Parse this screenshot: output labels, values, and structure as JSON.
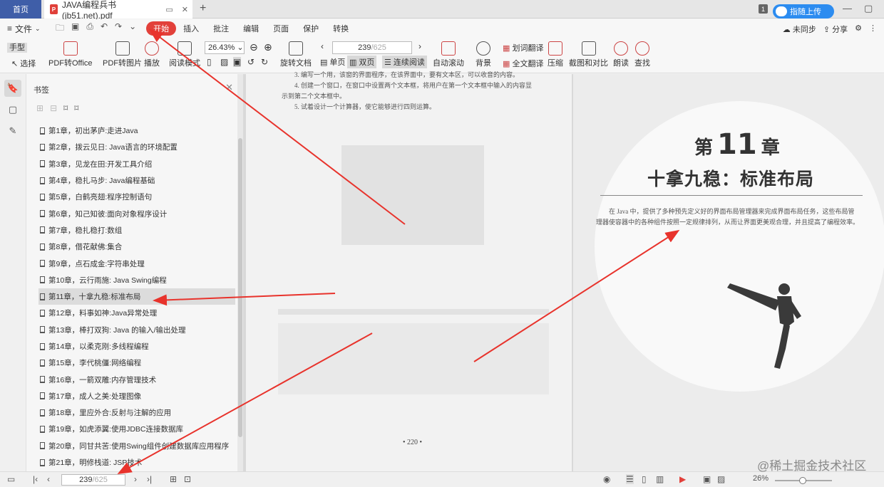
{
  "titlebar": {
    "home_tab": "首页",
    "doc_tab": "JAVA编程兵书(jb51.net).pdf",
    "badge": "1",
    "upload": "指随上传"
  },
  "menubar": {
    "file": "文件",
    "items": [
      "开始",
      "插入",
      "批注",
      "编辑",
      "页面",
      "保护",
      "转换"
    ],
    "right": [
      "未同步",
      "分享"
    ]
  },
  "ribbon": {
    "hand": "手型",
    "select": "选择",
    "pdf_office": "PDF转Office",
    "pdf_image": "PDF转图片",
    "play": "播放",
    "read_mode": "阅读模式",
    "zoom": "26.43%",
    "page_current": "239",
    "page_total": "/625",
    "rotate": "旋转文档",
    "single": "单页",
    "double": "双页",
    "continuous": "连续阅读",
    "autoscroll": "自动滚动",
    "background": "背景",
    "word_translate": "划词翻译",
    "full_translate": "全文翻译",
    "compress": "压缩",
    "screenshot": "截图和对比",
    "read_aloud": "朗读",
    "find": "查找"
  },
  "bookmarks": {
    "title": "书签",
    "items": [
      "第1章，初出茅庐:走进Java",
      "第2章，拨云见日: Java语言的环境配置",
      "第3章，见龙在田:开发工具介绍",
      "第4章，稳扎马步: Java编程基础",
      "第5章，白鹤亮翅:程序控制语句",
      "第6章，知己知彼:面向对象程序设计",
      "第7章，稳扎稳打:数组",
      "第8章，借花献佛:集合",
      "第9章，点石成金:字符串处理",
      "第10章，云行雨施: Java Swing编程",
      "第11章，十拿九稳:标准布局",
      "第12章，料事如神:Java异常处理",
      "第13章，棒打双狗: Java 的输入/输出处理",
      "第14章，以柔克刚:多线程编程",
      "第15章，李代桃僵:网络编程",
      "第16章，一箭双雕:内存管理技术",
      "第17章，成人之美:处理图像",
      "第18章，里应外合:反射与注解的应用",
      "第19章，如虎添翼:使用JDBC连接数据库",
      "第20章，同甘共苦:使用Swing组件创建数据库应用程序",
      "第21章，明修栈道: JSP技术"
    ],
    "selected_index": 10
  },
  "page_left": {
    "lines": [
      "3.  编写一个用，该窗的界面程序，在该界面中，要有文本区，可以收音的内容。",
      "4.  创建一个窗口，在窗口中设置两个文本框，将用户在第一个文本框中输入的内容显",
      "示到第二个文本框中。",
      "5.  试着设计一个计算器，使它能够进行四则运算。"
    ],
    "page_number": "• 220 •"
  },
  "page_right": {
    "chapter_prefix": "第",
    "chapter_number": "11",
    "chapter_suffix": "章",
    "chapter_title": "十拿九稳：标准布局",
    "intro": "在 Java 中，提供了多种预先定义好的界面布局管理器来完成界面布局任务，这些布局管理器使容器中的各种组件按照一定规律排列，从而让界面更美观合理，并且提高了编程效率。"
  },
  "statusbar": {
    "page_current": "239",
    "page_total": "/625",
    "zoom": "26%"
  },
  "watermark": "@稀土掘金技术社区",
  "colors": {
    "accent": "#e2403a",
    "home": "#3f5ea8",
    "upload": "#2c8cf0",
    "arrow": "#e8332c"
  }
}
